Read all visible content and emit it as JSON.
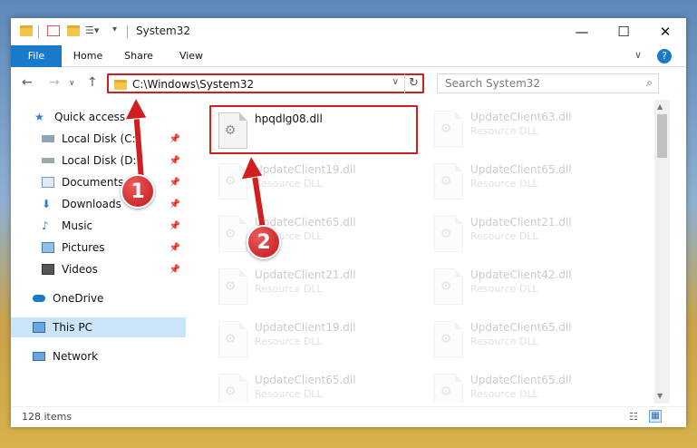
{
  "window": {
    "title": "System32",
    "minimize": "—",
    "maximize": "☐",
    "close": "✕"
  },
  "ribbon": {
    "tabs": [
      "File",
      "Home",
      "Share",
      "View"
    ],
    "collapse": "∨",
    "help": "?"
  },
  "address": {
    "path": "C:\\Windows\\System32",
    "search_placeholder": "Search System32"
  },
  "nav": {
    "items": [
      {
        "label": "Quick access",
        "icon": "star-icon",
        "pinned": false
      },
      {
        "label": "Local Disk (C:)",
        "icon": "drive-icon",
        "pinned": true
      },
      {
        "label": "Local Disk (D:)",
        "icon": "drive-icon",
        "pinned": true
      },
      {
        "label": "Documents",
        "icon": "documents-icon",
        "pinned": true
      },
      {
        "label": "Downloads",
        "icon": "downloads-icon",
        "pinned": true
      },
      {
        "label": "Music",
        "icon": "music-icon",
        "pinned": true
      },
      {
        "label": "Pictures",
        "icon": "pictures-icon",
        "pinned": true
      },
      {
        "label": "Videos",
        "icon": "videos-icon",
        "pinned": true
      },
      {
        "label": "OneDrive",
        "icon": "cloud-icon",
        "pinned": false
      },
      {
        "label": "This PC",
        "icon": "computer-icon",
        "pinned": false
      },
      {
        "label": "Network",
        "icon": "network-icon",
        "pinned": false
      }
    ]
  },
  "files": {
    "left": [
      {
        "name": "hpqdlg08.dll",
        "type": ""
      },
      {
        "name": "UpdateClient19.dll",
        "type": "Resource DLL"
      },
      {
        "name": "UpdateClient65.dll",
        "type": "Resource DLL"
      },
      {
        "name": "UpdateClient21.dll",
        "type": "Resource DLL"
      },
      {
        "name": "UpdateClient19.dll",
        "type": "Resource DLL"
      },
      {
        "name": "UpdateClient65.dll",
        "type": "Resource DLL"
      }
    ],
    "right": [
      {
        "name": "UpdateClient63.dll",
        "type": "Resource DLL"
      },
      {
        "name": "UpdateClient65.dll",
        "type": "Resource DLL"
      },
      {
        "name": "UpdateClient21.dll",
        "type": "Resource DLL"
      },
      {
        "name": "UpdateClient42.dll",
        "type": "Resource DLL"
      },
      {
        "name": "UpdateClient65.dll",
        "type": "Resource DLL"
      },
      {
        "name": "UpdateClient65.dll",
        "type": "Resource DLL"
      }
    ]
  },
  "status": {
    "count": "128 items"
  },
  "annotations": {
    "step1": "1",
    "step2": "2"
  },
  "colors": {
    "accent": "#1979ca",
    "highlight": "#d11f1f",
    "selected": "#cce4f7"
  }
}
